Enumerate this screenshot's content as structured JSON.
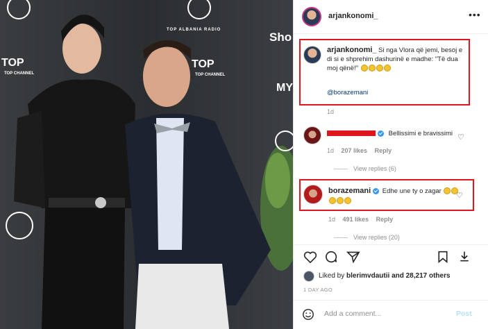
{
  "post": {
    "author": "arjankonomi_",
    "caption_user": "arjankonomi_",
    "caption_text": "Si nga Vlora që jemi, besoj e di si e shprehim dashurinë e madhe: \"Të dua moj qënë!\"",
    "mention": "@borazemani",
    "caption_age": "1d",
    "likes_text_prefix": "Liked by",
    "likes_user": "blerimvdautii",
    "likes_text_suffix": "and 28,217 others",
    "date": "1 DAY AGO",
    "comment_placeholder": "Add a comment...",
    "post_label": "Post"
  },
  "comments": [
    {
      "text": "Bellissimi e bravissimi",
      "age": "1d",
      "likes": "207 likes",
      "reply": "Reply",
      "view_replies": "View replies (6)"
    },
    {
      "user": "borazemani",
      "text": "Edhe une ty o zagar",
      "age": "1d",
      "likes": "491 likes",
      "reply": "Reply",
      "view_replies": "View replies (20)"
    }
  ],
  "photo_brand": {
    "top_channel": "TOP CHANNEL",
    "top_albania_radio": "TOP ALBANIA RADIO",
    "show": "Sho",
    "mus": "MY"
  },
  "icons": {
    "more": "more-icon",
    "heart": "heart-icon",
    "comment": "comment-icon",
    "share": "share-icon",
    "save": "bookmark-icon"
  },
  "colors": {
    "highlight": "#e0161e",
    "verified": "#3897f0",
    "post_button": "#b2dffc"
  }
}
